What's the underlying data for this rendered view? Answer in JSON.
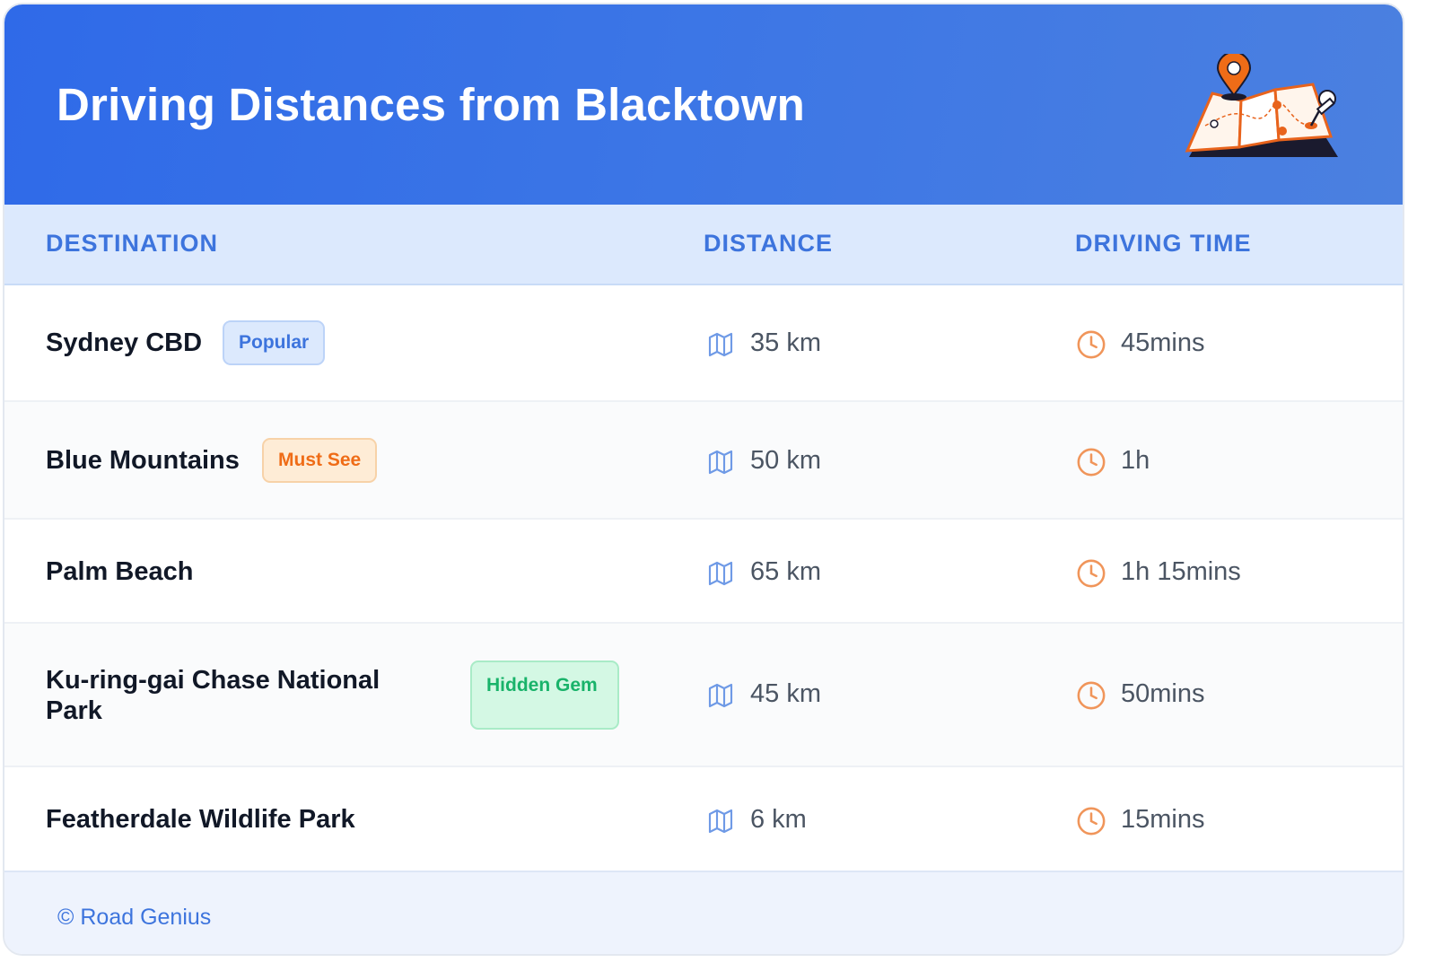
{
  "header": {
    "title": "Driving Distances from Blacktown"
  },
  "columns": {
    "destination": "DESTINATION",
    "distance": "DISTANCE",
    "driving_time": "DRIVING TIME"
  },
  "rows": [
    {
      "destination": "Sydney CBD",
      "badge": "Popular",
      "distance": "35 km",
      "time": "45mins"
    },
    {
      "destination": "Blue Mountains",
      "badge": "Must See",
      "distance": "50 km",
      "time": "1h"
    },
    {
      "destination": "Palm Beach",
      "distance": "65 km",
      "time": "1h 15mins"
    },
    {
      "destination": "Ku-ring-gai Chase National Park",
      "badge": "Hidden Gem",
      "distance": "45 km",
      "time": "50mins"
    },
    {
      "destination": "Featherdale Wildlife Park",
      "distance": "6 km",
      "time": "15mins"
    }
  ],
  "icons": {
    "header": "map-pin-illustration-icon",
    "distance": "map-icon",
    "time": "clock-icon"
  },
  "colors": {
    "header_start": "#2f6ae8",
    "header_end": "#4b80e0",
    "accent_blue": "#3d74dd",
    "badge_orange": "#ef6c17",
    "badge_green": "#19b36a",
    "clock_orange": "#f0955a",
    "map_blue": "#6f9ae6"
  },
  "footer": {
    "text": "© Road Genius"
  }
}
